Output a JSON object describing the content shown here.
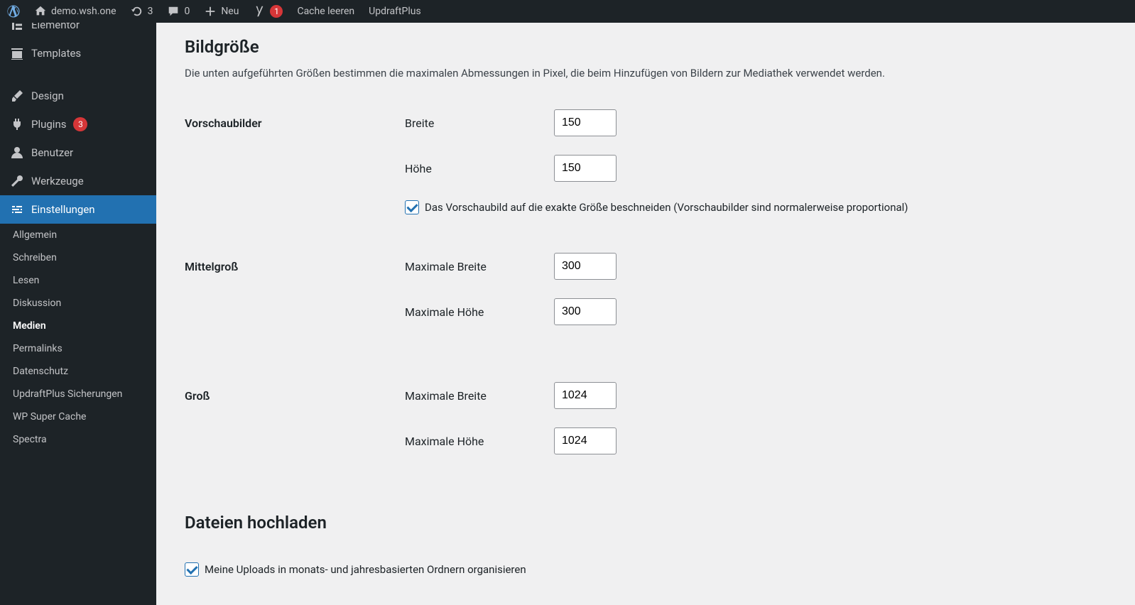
{
  "adminbar": {
    "site": "demo.wsh.one",
    "updates": "3",
    "comments": "0",
    "new": "Neu",
    "yoast_badge": "1",
    "cache_clear": "Cache leeren",
    "updraft": "UpdraftPlus"
  },
  "sidebar": {
    "elementor": "Elementor",
    "templates": "Templates",
    "design": "Design",
    "plugins": "Plugins",
    "plugins_count": "3",
    "users": "Benutzer",
    "tools": "Werkzeuge",
    "settings": "Einstellungen"
  },
  "submenu": {
    "general": "Allgemein",
    "writing": "Schreiben",
    "reading": "Lesen",
    "discussion": "Diskussion",
    "media": "Medien",
    "permalinks": "Permalinks",
    "privacy": "Datenschutz",
    "updraft": "UpdraftPlus Sicherungen",
    "supercache": "WP Super Cache",
    "spectra": "Spectra"
  },
  "content": {
    "h_image_size": "Bildgröße",
    "desc": "Die unten aufgeführten Größen bestimmen die maximalen Abmessungen in Pixel, die beim Hinzufügen von Bildern zur Mediathek verwendet werden.",
    "thumb_label": "Vorschaubilder",
    "width": "Breite",
    "height": "Höhe",
    "thumb_w": "150",
    "thumb_h": "150",
    "crop_text": "Das Vorschaubild auf die exakte Größe beschneiden (Vorschaubilder sind normalerweise proportional)",
    "medium_label": "Mittelgroß",
    "max_width": "Maximale Breite",
    "max_height": "Maximale Höhe",
    "medium_w": "300",
    "medium_h": "300",
    "large_label": "Groß",
    "large_w": "1024",
    "large_h": "1024",
    "h_upload": "Dateien hochladen",
    "organize_text": "Meine Uploads in monats- und jahresbasierten Ordnern organisieren"
  }
}
